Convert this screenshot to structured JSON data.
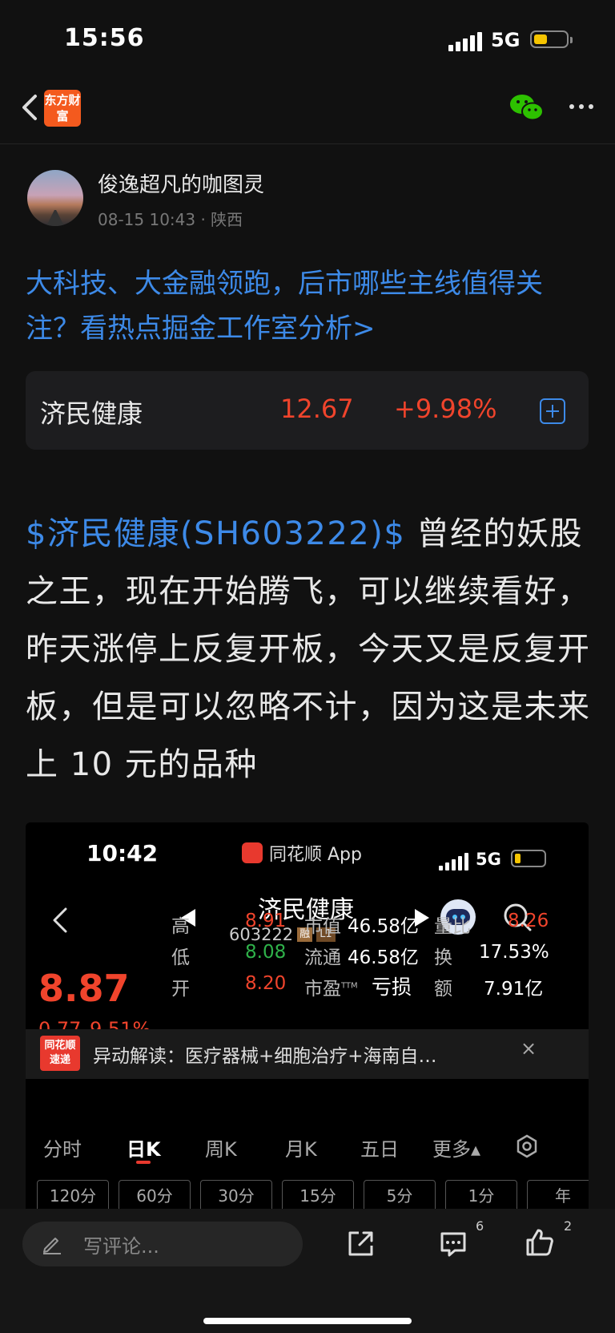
{
  "status_bar": {
    "time": "15:56",
    "network": "5G"
  },
  "nav": {
    "logo_text": "东方财富"
  },
  "author": {
    "name": "俊逸超凡的咖图灵",
    "meta": "08-15 10:43 · 陕西"
  },
  "headline": "大科技、大金融领跑，后市哪些主线值得关注？看热点掘金工作室分析>",
  "quote": {
    "name": "济民健康",
    "price": "12.67",
    "change": "+9.98%"
  },
  "post": {
    "tag": "$济民健康(SH603222)$",
    "text": " 曾经的妖股之王，现在开始腾飞，可以继续看好，昨天涨停上反复开板，今天又是反复开板，但是可以忽略不计，因为这是未来上 10 元的品种"
  },
  "screenshot": {
    "time": "10:42",
    "app": "同花顺 App",
    "network": "5G",
    "title": "济民健康",
    "code": "603222",
    "badge1": "融",
    "badge2": "L1",
    "price": "8.87",
    "change": "0.77",
    "change_pct": "9.51%",
    "stats": {
      "high_label": "高",
      "high": "8.91",
      "low_label": "低",
      "low": "8.08",
      "open_label": "开",
      "open": "8.20",
      "mcap_label": "市值",
      "mcap": "46.58亿",
      "float_label": "流通",
      "float": "46.58亿",
      "pe_label": "市盈",
      "pe_sup": "TTM",
      "pe": "亏损",
      "vr_label": "量比",
      "vr": "8.26",
      "turn_label": "换",
      "turn": "17.53%",
      "amt_label": "额",
      "amt": "7.91亿"
    },
    "banner": {
      "logo": "同花顺速递",
      "text": "异动解读：医疗器械+细胞治疗+海南自…",
      "close": "×"
    },
    "tabs": [
      "分时",
      "日K",
      "周K",
      "月K",
      "五日",
      "更多▴"
    ],
    "chips": [
      "120分",
      "60分",
      "30分",
      "15分",
      "5分",
      "1分",
      "年"
    ]
  },
  "bottom": {
    "comment_placeholder": "写评论...",
    "comment_count": "6",
    "like_count": "2"
  }
}
